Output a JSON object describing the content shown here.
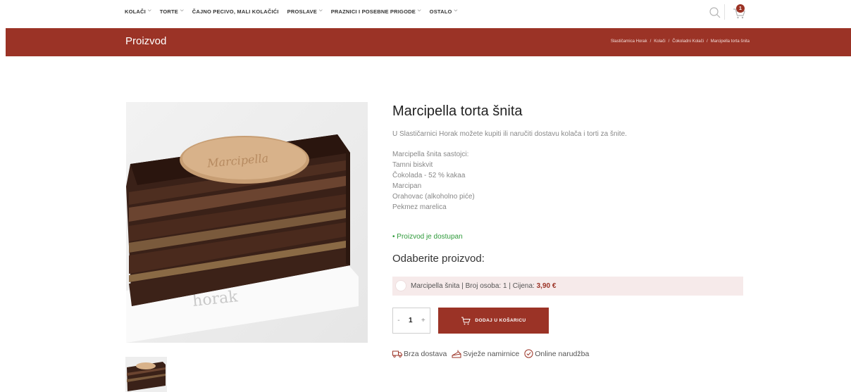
{
  "nav": {
    "items": [
      {
        "label": "KOLAČI",
        "dropdown": true
      },
      {
        "label": "TORTE",
        "dropdown": true
      },
      {
        "label": "ČAJNO PECIVO, MALI KOLAČIĆI",
        "dropdown": false
      },
      {
        "label": "PROSLAVE",
        "dropdown": true
      },
      {
        "label": "PRAZNICI I POSEBNE PRIGODE",
        "dropdown": true
      },
      {
        "label": "OSTALO",
        "dropdown": true
      }
    ],
    "cart_count": "1"
  },
  "banner": {
    "title": "Proizvod",
    "breadcrumb": [
      "Slastičarnica Horak",
      "Kolači",
      "Čokoladni Kolači",
      "Marcipella torta šnita"
    ],
    "separator": "/"
  },
  "product": {
    "image_text": "horak",
    "title": "Marcipella torta šnita",
    "intro": "U Slastičarnici Horak možete kupiti ili naručiti dostavu kolača i torti za šnite.",
    "ingredients": [
      "Marcipella šnita sastojci:",
      "Tamni biskvit",
      "Čokolada - 52 % kakaa",
      "Marcipan",
      "Orahovac (alkoholno piće)",
      "Pekmez marelica"
    ],
    "stock": "• Proizvod je dostupan",
    "select_heading": "Odaberite proizvod:",
    "option": {
      "text": "Marcipella šnita | Broj osoba: 1 | Cijena: ",
      "price": "3,90 €"
    },
    "quantity": {
      "minus": "-",
      "value": "1",
      "plus": "+"
    },
    "add_to_cart": "DODAJ U KOŠARICU",
    "features": [
      {
        "icon": "truck-icon",
        "label": "Brza dostava"
      },
      {
        "icon": "cake-icon",
        "label": "Svježe namirnice"
      },
      {
        "icon": "check-circle-icon",
        "label": "Online narudžba"
      }
    ]
  },
  "colors": {
    "brand": "#9b3326",
    "stock": "#2e9a3a",
    "option_bg": "#f6eaea"
  }
}
